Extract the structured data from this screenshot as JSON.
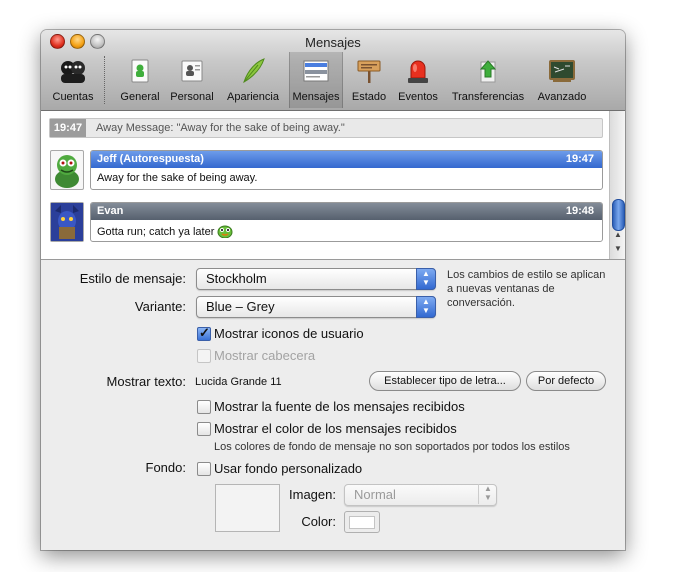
{
  "window": {
    "title": "Mensajes"
  },
  "toolbar": {
    "items": [
      {
        "label": "Cuentas",
        "icon": "accounts-icon"
      },
      {
        "label": "General",
        "icon": "general-icon"
      },
      {
        "label": "Personal",
        "icon": "personal-icon"
      },
      {
        "label": "Apariencia",
        "icon": "appearance-icon"
      },
      {
        "label": "Mensajes",
        "icon": "messages-icon",
        "selected": true
      },
      {
        "label": "Estado",
        "icon": "status-icon"
      },
      {
        "label": "Eventos",
        "icon": "events-icon"
      },
      {
        "label": "Transferencias",
        "icon": "transfers-icon"
      },
      {
        "label": "Avanzado",
        "icon": "advanced-icon"
      }
    ]
  },
  "preview": {
    "status_time": "19:47",
    "status_text": "Away Message: \"Away for the sake of being away.\"",
    "messages": [
      {
        "sender": "Jeff (Autorespuesta)",
        "time": "19:47",
        "text": "Away for the sake of being away.",
        "header_color": "#3d71d6"
      },
      {
        "sender": "Evan",
        "time": "19:48",
        "text": "Gotta run; catch ya later",
        "header_color": "#5f6874"
      }
    ]
  },
  "form": {
    "style_label": "Estilo de mensaje:",
    "style_value": "Stockholm",
    "style_note": "Los cambios de estilo se aplican a nuevas ventanas de conversación.",
    "variant_label": "Variante:",
    "variant_value": "Blue – Grey",
    "show_user_icons": "Mostrar iconos de usuario",
    "show_header": "Mostrar cabecera",
    "show_text_label": "Mostrar texto:",
    "font_value": "Lucida Grande 11",
    "set_font_button": "Establecer tipo de letra...",
    "default_button": "Por defecto",
    "show_font": "Mostrar la fuente de los mensajes recibidos",
    "show_color": "Mostrar el color de los mensajes recibidos",
    "color_note": "Los colores de fondo de mensaje no son soportados por todos los estilos",
    "background_label": "Fondo:",
    "custom_background": "Usar fondo personalizado",
    "image_label": "Imagen:",
    "image_value": "Normal",
    "color_label": "Color:"
  }
}
